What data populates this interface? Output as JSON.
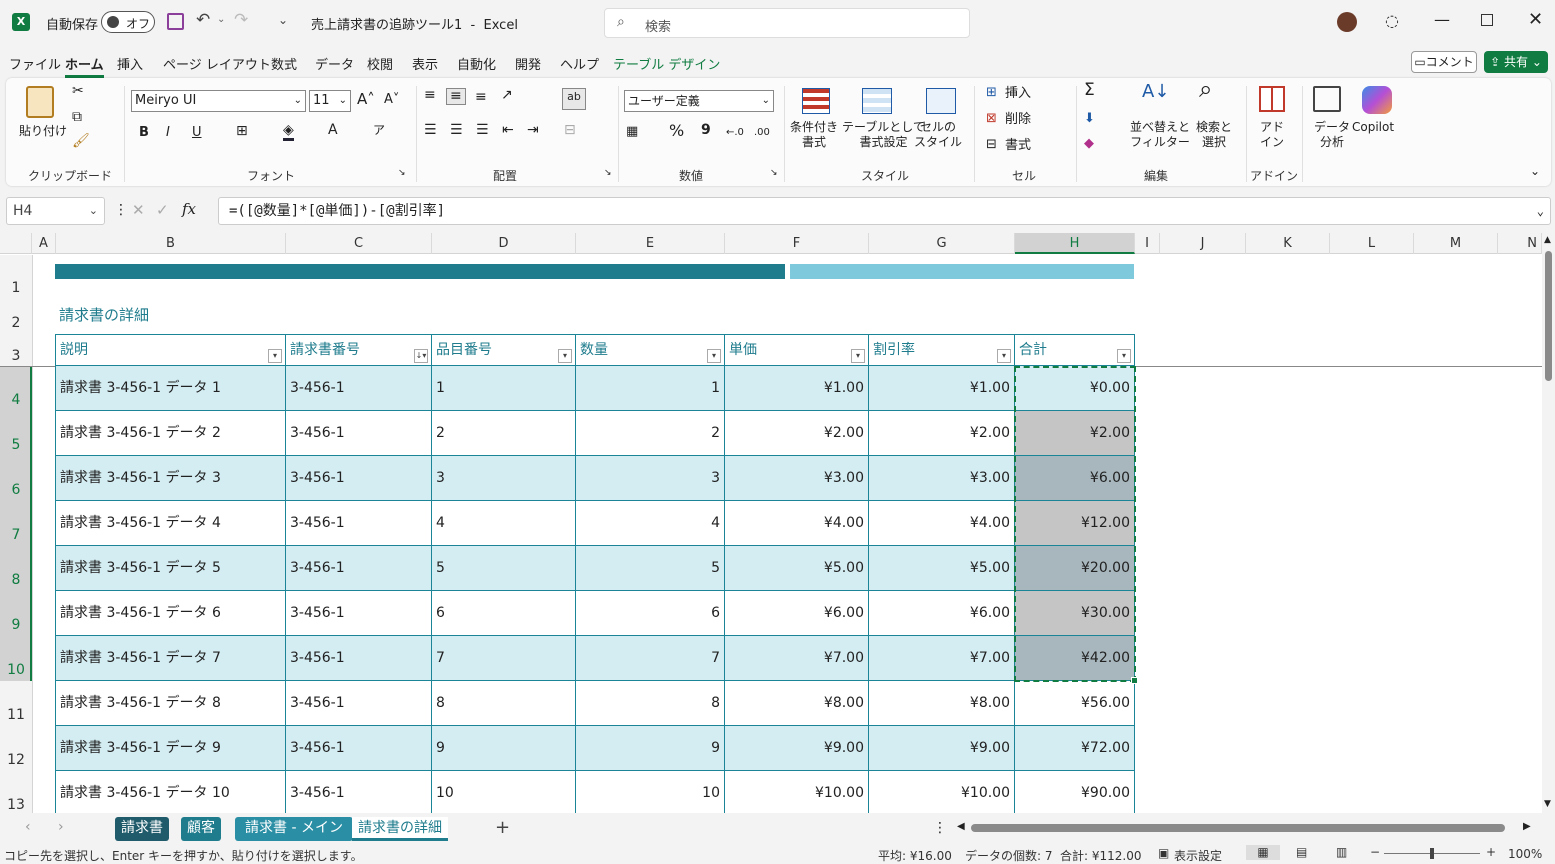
{
  "titlebar": {
    "autosave_label": "自動保存",
    "autosave_toggle": "オフ",
    "doc_title": "売上請求書の追跡ツール1  -  Excel",
    "search_placeholder": "検索"
  },
  "menu": [
    "ファイル",
    "ホーム",
    "挿入",
    "ページ レイアウト",
    "数式",
    "データ",
    "校閲",
    "表示",
    "自動化",
    "開発",
    "ヘルプ",
    "テーブル デザイン"
  ],
  "menu_active": "ホーム",
  "comment_btn": "コメント",
  "share_btn": "共有",
  "ribbon": {
    "clipboard": {
      "paste": "貼り付け",
      "label": "クリップボード"
    },
    "font": {
      "name": "Meiryo UI",
      "size": "11",
      "label": "フォント",
      "bold": "B",
      "italic": "I",
      "underline": "U"
    },
    "align": {
      "label": "配置"
    },
    "number": {
      "format": "ユーザー定義",
      "label": "数値",
      "percent": "%",
      "comma": "9"
    },
    "style": {
      "cond": "条件付き\n書式",
      "table": "テーブルとして\n書式設定",
      "cell": "セルの\nスタイル",
      "label": "スタイル"
    },
    "cells": {
      "insert": "挿入",
      "delete": "削除",
      "format": "書式",
      "label": "セル"
    },
    "edit": {
      "sort": "並べ替えと\nフィルター",
      "find": "検索と\n選択",
      "label": "編集"
    },
    "addin": {
      "addin": "アド\nイン",
      "label": "アドイン",
      "analyze": "データ\n分析",
      "copilot": "Copilot"
    }
  },
  "formula": {
    "namebox": "H4",
    "formula": "=([@数量]*[@単価])-[@割引率]"
  },
  "columns": [
    "A",
    "B",
    "C",
    "D",
    "E",
    "F",
    "G",
    "H",
    "I",
    "J",
    "K",
    "L",
    "M",
    "N"
  ],
  "sheet_title": "請求書の詳細",
  "table_headers": [
    "説明",
    "請求書番号",
    "品目番号",
    "数量",
    "単価",
    "割引率",
    "合計"
  ],
  "rows": [
    [
      "請求書 3-456-1 データ 1",
      "3-456-1",
      "1",
      "1",
      "¥1.00",
      "¥1.00",
      "¥0.00"
    ],
    [
      "請求書 3-456-1 データ 2",
      "3-456-1",
      "2",
      "2",
      "¥2.00",
      "¥2.00",
      "¥2.00"
    ],
    [
      "請求書 3-456-1 データ 3",
      "3-456-1",
      "3",
      "3",
      "¥3.00",
      "¥3.00",
      "¥6.00"
    ],
    [
      "請求書 3-456-1 データ 4",
      "3-456-1",
      "4",
      "4",
      "¥4.00",
      "¥4.00",
      "¥12.00"
    ],
    [
      "請求書 3-456-1 データ 5",
      "3-456-1",
      "5",
      "5",
      "¥5.00",
      "¥5.00",
      "¥20.00"
    ],
    [
      "請求書 3-456-1 データ 6",
      "3-456-1",
      "6",
      "6",
      "¥6.00",
      "¥6.00",
      "¥30.00"
    ],
    [
      "請求書 3-456-1 データ 7",
      "3-456-1",
      "7",
      "7",
      "¥7.00",
      "¥7.00",
      "¥42.00"
    ],
    [
      "請求書 3-456-1 データ 8",
      "3-456-1",
      "8",
      "8",
      "¥8.00",
      "¥8.00",
      "¥56.00"
    ],
    [
      "請求書 3-456-1 データ 9",
      "3-456-1",
      "9",
      "9",
      "¥9.00",
      "¥9.00",
      "¥72.00"
    ],
    [
      "請求書 3-456-1 データ 10",
      "3-456-1",
      "10",
      "10",
      "¥10.00",
      "¥10.00",
      "¥90.00"
    ]
  ],
  "row_numbers": [
    "1",
    "2",
    "3",
    "4",
    "5",
    "6",
    "7",
    "8",
    "9",
    "10",
    "11",
    "12",
    "13"
  ],
  "sheet_tabs": [
    "請求書",
    "顧客",
    "請求書 - メイン",
    "請求書の詳細"
  ],
  "active_sheet": "請求書の詳細",
  "status": {
    "message": "コピー先を選択し、Enter キーを押すか、貼り付けを選択します。",
    "average": "平均: ¥16.00",
    "count": "データの個数: 7",
    "sum": "合計: ¥112.00",
    "display_settings": "表示設定",
    "zoom": "100%"
  },
  "colors": {
    "accent": "#1f7c8d",
    "band_light": "#d4edf3",
    "selection_fill": "#a8b7bd",
    "excel_green": "#107c41"
  }
}
